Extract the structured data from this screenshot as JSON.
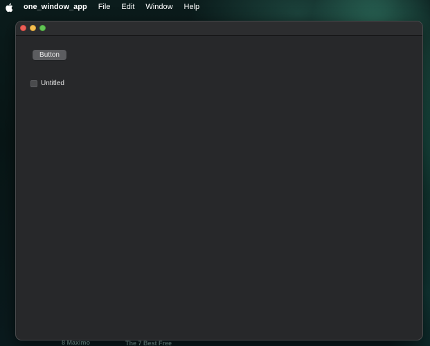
{
  "menubar": {
    "apple_icon": "apple-logo-icon",
    "app_name": "one_window_app",
    "items": [
      {
        "label": "File"
      },
      {
        "label": "Edit"
      },
      {
        "label": "Window"
      },
      {
        "label": "Help"
      }
    ]
  },
  "window": {
    "traffic_lights": {
      "close_color": "#ec5f57",
      "minimize_color": "#f4be4f",
      "zoom_color": "#61c554"
    },
    "button_label": "Button",
    "checkbox": {
      "label": "Untitled",
      "checked": false
    }
  },
  "desktop": {
    "background_texts": [
      "8 Maximo",
      "The 7 Best Free"
    ]
  }
}
